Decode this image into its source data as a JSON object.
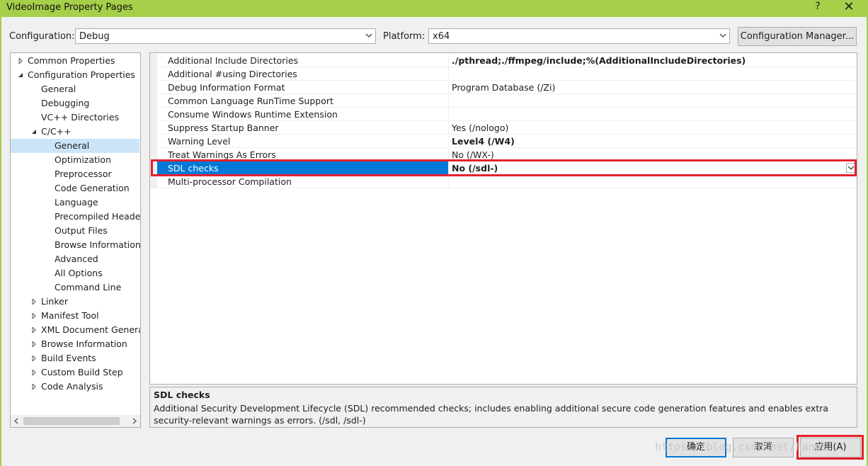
{
  "window": {
    "title": "VideoImage Property Pages",
    "help_label": "?",
    "close_label": "✕",
    "accent_color": "#a6cf4a"
  },
  "config_bar": {
    "configuration_label": "Configuration:",
    "configuration_value": "Debug",
    "platform_label": "Platform:",
    "platform_value": "x64",
    "manager_button": "Configuration Manager..."
  },
  "tree": {
    "items": [
      {
        "label": "Common Properties",
        "level": 0,
        "expander": "collapsed"
      },
      {
        "label": "Configuration Properties",
        "level": 0,
        "expander": "expanded"
      },
      {
        "label": "General",
        "level": 1,
        "expander": "none"
      },
      {
        "label": "Debugging",
        "level": 1,
        "expander": "none"
      },
      {
        "label": "VC++ Directories",
        "level": 1,
        "expander": "none"
      },
      {
        "label": "C/C++",
        "level": 1,
        "expander": "expanded"
      },
      {
        "label": "General",
        "level": 2,
        "expander": "none",
        "selected": true
      },
      {
        "label": "Optimization",
        "level": 2,
        "expander": "none"
      },
      {
        "label": "Preprocessor",
        "level": 2,
        "expander": "none"
      },
      {
        "label": "Code Generation",
        "level": 2,
        "expander": "none"
      },
      {
        "label": "Language",
        "level": 2,
        "expander": "none"
      },
      {
        "label": "Precompiled Headers",
        "level": 2,
        "expander": "none"
      },
      {
        "label": "Output Files",
        "level": 2,
        "expander": "none"
      },
      {
        "label": "Browse Information",
        "level": 2,
        "expander": "none"
      },
      {
        "label": "Advanced",
        "level": 2,
        "expander": "none"
      },
      {
        "label": "All Options",
        "level": 2,
        "expander": "none"
      },
      {
        "label": "Command Line",
        "level": 2,
        "expander": "none"
      },
      {
        "label": "Linker",
        "level": 1,
        "expander": "collapsed"
      },
      {
        "label": "Manifest Tool",
        "level": 1,
        "expander": "collapsed"
      },
      {
        "label": "XML Document Generator",
        "level": 1,
        "expander": "collapsed"
      },
      {
        "label": "Browse Information",
        "level": 1,
        "expander": "collapsed"
      },
      {
        "label": "Build Events",
        "level": 1,
        "expander": "collapsed"
      },
      {
        "label": "Custom Build Step",
        "level": 1,
        "expander": "collapsed"
      },
      {
        "label": "Code Analysis",
        "level": 1,
        "expander": "collapsed"
      }
    ]
  },
  "grid": {
    "rows": [
      {
        "name": "Additional Include Directories",
        "value": "./pthread;./ffmpeg/include;%(AdditionalIncludeDirectories)",
        "bold": true
      },
      {
        "name": "Additional #using Directories",
        "value": "",
        "bold": false
      },
      {
        "name": "Debug Information Format",
        "value": "Program Database (/Zi)",
        "bold": false
      },
      {
        "name": "Common Language RunTime Support",
        "value": "",
        "bold": false
      },
      {
        "name": "Consume Windows Runtime Extension",
        "value": "",
        "bold": false
      },
      {
        "name": "Suppress Startup Banner",
        "value": "Yes (/nologo)",
        "bold": false
      },
      {
        "name": "Warning Level",
        "value": "Level4 (/W4)",
        "bold": true
      },
      {
        "name": "Treat Warnings As Errors",
        "value": "No (/WX-)",
        "bold": false
      },
      {
        "name": "SDL checks",
        "value": "No (/sdl-)",
        "bold": true,
        "selected": true
      },
      {
        "name": "Multi-processor Compilation",
        "value": "",
        "bold": false
      }
    ]
  },
  "description": {
    "title": "SDL checks",
    "text": "Additional Security Development Lifecycle (SDL) recommended checks; includes enabling additional secure code generation features and enables extra security-relevant warnings as errors.     (/sdl, /sdl-)"
  },
  "buttons": {
    "ok": "确定",
    "cancel": "取消",
    "apply": "应用(A)"
  },
  "watermark": "https://blog.csdn.net/hanni",
  "highlight_color": "#e3222d"
}
